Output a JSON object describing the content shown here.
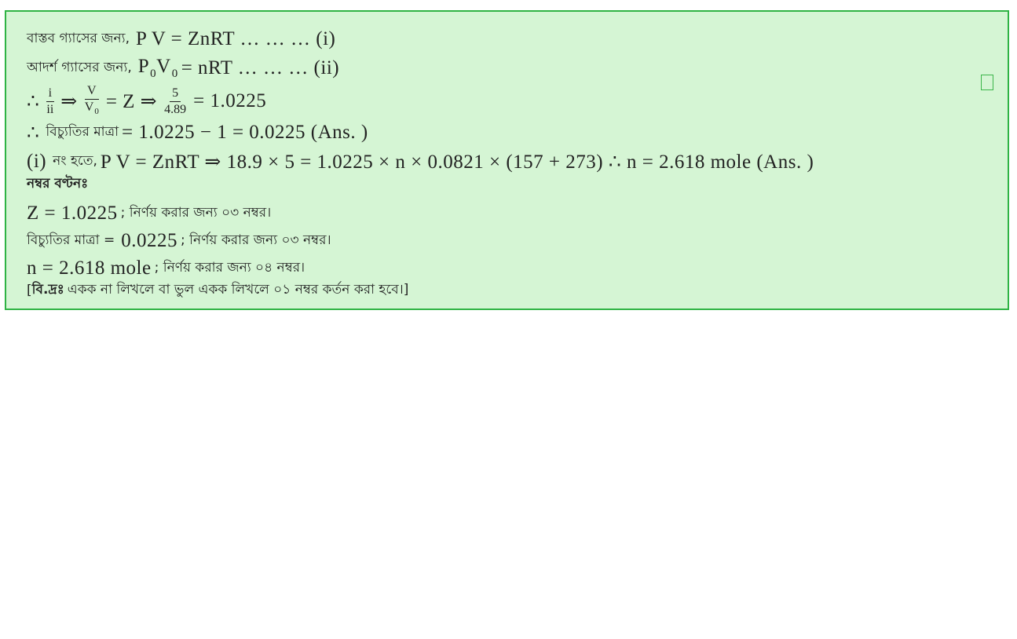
{
  "lines": {
    "l1": {
      "bn": "বাস্তব গ্যাসের জন্য,",
      "math": "P V =  ZnRT …  …  …  (i)"
    },
    "l2": {
      "bn": "আদর্শ গ্যাসের জন্য,",
      "p": "P",
      "p_sub": "0",
      "v": "V",
      "v_sub": "0",
      "rest": "=  nRT …  …  …  (ii)"
    },
    "l3": {
      "therefore": "∴",
      "f1_num": "i",
      "f1_den": "ii",
      "arrow1": "⇒",
      "f2_num": "V",
      "f2_den": "V",
      "f2_den_sub": "0",
      "mid": "=  Z ⇒",
      "f3_num": "5",
      "f3_den": "4.89",
      "result": "=  1.0225"
    },
    "l4": {
      "therefore": "∴",
      "bn": "বিচ্যুতির মাত্রা",
      "math": "=  1.0225 −  1 =  0.0225 (Ans. )"
    },
    "l5": {
      "pre": "(i)",
      "bn": "নং হতে,",
      "math": "P V =  ZnRT ⇒  18.9 ×  5 =  1.0225 ×  n ×  0.0821 ×  (157 +  273) ∴ n =  2.618 mole (Ans. )"
    },
    "marks_heading": "নম্বর বণ্টনঃ",
    "m1": {
      "math": "Z =  1.0225",
      "bn": "; নির্ণয় করার জন্য ০৩ নম্বর।"
    },
    "m2": {
      "bn_pre": "বিচ্যুতির মাত্রা =",
      "math": "0.0225",
      "bn": "; নির্ণয় করার জন্য ০৩ নম্বর।"
    },
    "m3": {
      "math": "n =  2.618 mole",
      "bn": "; নির্ণয় করার জন্য ০৪ নম্বর।"
    },
    "note": {
      "open": "[",
      "label": "বি.দ্রঃ",
      "text": "একক না লিখলে বা ভুল একক লিখলে ০১ নম্বর কর্তন করা হবে।]"
    }
  },
  "colors": {
    "box_background": "#d5f5d4",
    "box_border": "#2fb344",
    "text": "#222222"
  },
  "icons": {
    "corner": "empty-box-icon"
  }
}
